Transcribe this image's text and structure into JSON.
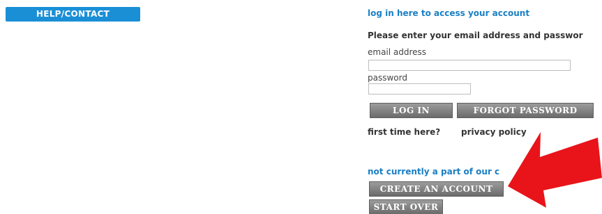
{
  "help": {
    "label": "HELP/CONTACT"
  },
  "login": {
    "title": "log in here to access your account",
    "instructions": "Please enter your email address and passwor",
    "email_label": "email address",
    "email_value": "",
    "password_label": "password",
    "password_value": "",
    "login_button": "LOG IN",
    "forgot_button": "FORGOT PASSWORD",
    "first_time_link": "first time here?",
    "privacy_link": "privacy policy"
  },
  "signup": {
    "prompt": "not currently a part of our c",
    "create_button": "CREATE AN ACCOUNT",
    "start_over_button": "START OVER"
  },
  "colors": {
    "help_button_bg": "#1a8fd6",
    "heading_blue": "#1a7fc4",
    "gray_button": "#7d7d7d",
    "arrow_red": "#e8141a"
  },
  "annotation": {
    "icon": "red-arrow-icon",
    "points_to": "create-account-button"
  }
}
